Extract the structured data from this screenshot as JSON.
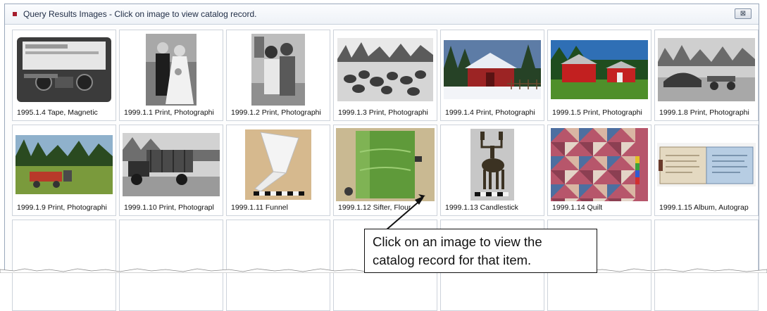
{
  "window": {
    "title": "Query Results Images - Click on image to view catalog record.",
    "close_glyph": "⊠",
    "accent_color": "#a51d2d"
  },
  "items": [
    {
      "caption": "1995.1.4 Tape, Magnetic",
      "icon": "cassette-tape"
    },
    {
      "caption": "1999.1.1 Print, Photographi",
      "icon": "wedding-photo"
    },
    {
      "caption": "1999.1.2 Print, Photographi",
      "icon": "couple-photo"
    },
    {
      "caption": "1999.1.3 Print, Photographi",
      "icon": "turkeys-photo"
    },
    {
      "caption": "1999.1.4 Print, Photographi",
      "icon": "red-barn-snow"
    },
    {
      "caption": "1999.1.5 Print, Photographi",
      "icon": "red-barn-summer"
    },
    {
      "caption": "1999.1.8 Print, Photographi",
      "icon": "haying-photo"
    },
    {
      "caption": "1999.1.9 Print, Photographi",
      "icon": "field-photo"
    },
    {
      "caption": "1999.1.10 Print, Photograpl",
      "icon": "truck-photo"
    },
    {
      "caption": "1999.1.11 Funnel",
      "icon": "funnel"
    },
    {
      "caption": "1999.1.12 Sifter, Flour",
      "icon": "flour-sifter"
    },
    {
      "caption": "1999.1.13 Candlestick",
      "icon": "candlestick"
    },
    {
      "caption": "1999.1.14 Quilt",
      "icon": "quilt"
    },
    {
      "caption": "1999.1.15 Album, Autograp",
      "icon": "autograph-album"
    },
    {
      "caption": "",
      "icon": ""
    },
    {
      "caption": "",
      "icon": ""
    },
    {
      "caption": "",
      "icon": ""
    },
    {
      "caption": "",
      "icon": ""
    },
    {
      "caption": "",
      "icon": ""
    },
    {
      "caption": "",
      "icon": ""
    },
    {
      "caption": "",
      "icon": ""
    }
  ],
  "callout": {
    "line1": "Click on an image to view the",
    "line2": "catalog record for that item."
  }
}
